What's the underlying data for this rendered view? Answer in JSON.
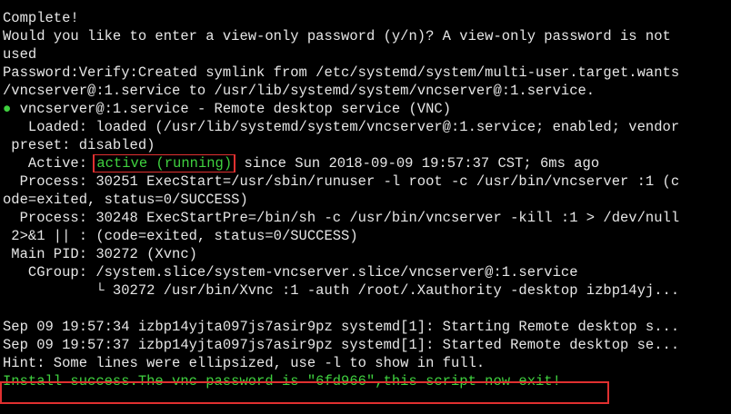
{
  "terminal": {
    "lines": [
      "Complete!",
      "Would you like to enter a view-only password (y/n)? A view-only password is not",
      "used",
      "Password:Verify:Created symlink from /etc/systemd/system/multi-user.target.wants",
      "/vncserver@:1.service to /usr/lib/systemd/system/vncserver@:1.service."
    ],
    "status": {
      "bullet": "●",
      "service_line": " vncserver@:1.service - Remote desktop service (VNC)",
      "loaded_line": "   Loaded: loaded (/usr/lib/systemd/system/vncserver@:1.service; enabled; vendor",
      "preset_line": " preset: disabled)",
      "active_prefix": "   Active: ",
      "active_state": "active (running)",
      "active_suffix": " since Sun 2018-09-09 19:57:37 CST; 6ms ago",
      "process1_line": "  Process: 30251 ExecStart=/usr/sbin/runuser -l root -c /usr/bin/vncserver :1 (c",
      "process1_cont": "ode=exited, status=0/SUCCESS)",
      "process2_line": "  Process: 30248 ExecStartPre=/bin/sh -c /usr/bin/vncserver -kill :1 > /dev/null",
      "process2_cont": " 2>&1 || : (code=exited, status=0/SUCCESS)",
      "mainpid_line": " Main PID: 30272 (Xvnc)",
      "cgroup_line": "   CGroup: /system.slice/system-vncserver.slice/vncserver@:1.service",
      "cgroup_child": "           └ 30272 /usr/bin/Xvnc :1 -auth /root/.Xauthority -desktop izbp14yj..."
    },
    "log": [
      "Sep 09 19:57:34 izbp14yjta097js7asir9pz systemd[1]: Starting Remote desktop s...",
      "Sep 09 19:57:37 izbp14yjta097js7asir9pz systemd[1]: Started Remote desktop se...",
      "Hint: Some lines were ellipsized, use -l to show in full."
    ],
    "final_message": "Install success.The vnc password is \"6fd966\",this script now exit!"
  },
  "colors": {
    "background": "#000000",
    "text": "#e6e6e6",
    "green": "#3fd13f",
    "highlight_box": "#e03030"
  }
}
